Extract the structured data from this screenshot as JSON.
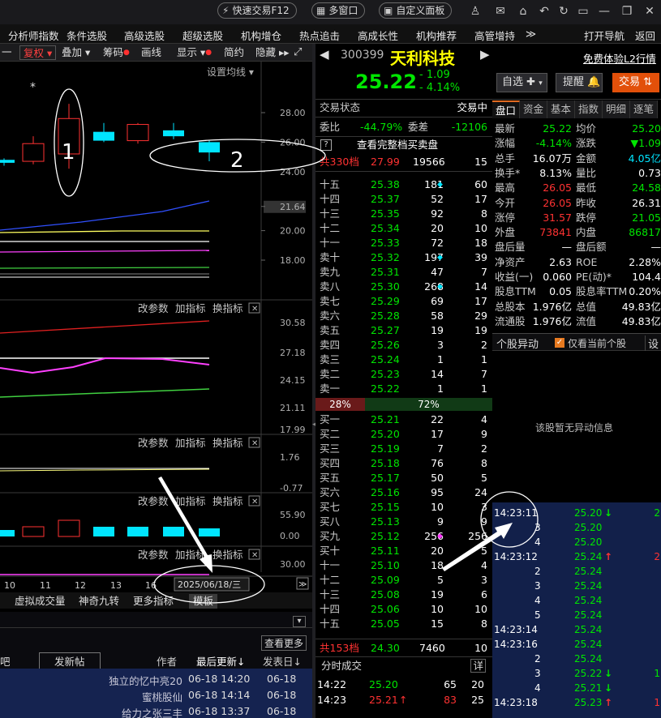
{
  "titlebar": {
    "quick_trade": "快速交易F12",
    "multi_window": "多窗口",
    "custom_panel": "自定义面板"
  },
  "menu": [
    "分析师指数",
    "条件选股",
    "高级选股",
    "超级选股",
    "机构增仓",
    "热点追击",
    "高成长性",
    "机构推荐",
    "高管增持",
    "≫",
    "打开导航",
    "返回"
  ],
  "toolbar": {
    "restore": "复权",
    "overlay": "叠加",
    "chips": "筹码",
    "draw": "画线",
    "display": "显示",
    "simple": "简约",
    "hide": "隐藏",
    "ma_setting": "设置均线"
  },
  "chart": {
    "candles": [
      {
        "open": 24.6,
        "close": 24.8,
        "high": 24.9,
        "low": 24.4,
        "color": "cyan"
      },
      {
        "open": 24.7,
        "close": 25.9,
        "high": 26.4,
        "low": 24.5,
        "color": "red"
      },
      {
        "open": 25.2,
        "close": 27.6,
        "high": 28.6,
        "low": 24.2,
        "color": "red"
      },
      {
        "open": 26.7,
        "close": 26.1,
        "high": 27.3,
        "low": 26.0,
        "color": "cyan"
      },
      {
        "open": 26.1,
        "close": 27.2,
        "high": 27.3,
        "low": 25.9,
        "color": "red"
      },
      {
        "open": 26.8,
        "close": 26.4,
        "high": 27.3,
        "low": 26.2,
        "color": "cyan"
      },
      {
        "open": 26.0,
        "close": 25.3,
        "high": 26.1,
        "low": 24.7,
        "color": "cyan"
      }
    ],
    "price_ticks": [
      "28.00",
      "26.00",
      "24.00",
      "21.64",
      "20.00",
      "18.00"
    ],
    "ind1_ticks": [
      "30.58",
      "27.18",
      "24.15",
      "21.11",
      "17.99"
    ],
    "ind2_ticks": [
      "1.76",
      "-0.77"
    ],
    "ind3_ticks": [
      "55.90",
      "0.00"
    ],
    "ind4_ticks": [
      "30.00"
    ],
    "panel_btns": [
      "改参数",
      "加指标",
      "换指标"
    ],
    "x_labels": [
      "10",
      "11",
      "12",
      "13",
      "16"
    ],
    "date_label": "2025/06/18/三",
    "annot1": "1",
    "annot2": "2",
    "star": "*"
  },
  "bottom_tabs": [
    "虚拟成交量",
    "神奇九转",
    "更多指标",
    "模板"
  ],
  "forum": {
    "more": "查看更多",
    "headers": [
      "吧",
      "发新帖",
      "作者",
      "最后更新↓",
      "发表日↓"
    ],
    "posts": [
      [
        "独立的忆中亮20",
        "06-18 14:20",
        "06-18"
      ],
      [
        "蜜桃股仙",
        "06-18 14:14",
        "06-18"
      ],
      [
        "给力之张三丰",
        "06-18 13:37",
        "06-18"
      ]
    ]
  },
  "stock": {
    "code": "300399",
    "name": "天利科技",
    "l2": "免费体验L2行情",
    "price": "25.22",
    "change": "- 1.09",
    "pct": "- 4.14%",
    "watch": "自选",
    "alert": "提醒",
    "trade": "交易"
  },
  "orderbook": {
    "status_label": "交易状态",
    "status": "交易中",
    "wb_label": "委比",
    "wb": "-44.79%",
    "wc_label": "委差",
    "wc": "-12106",
    "full_label": "查看完整档买卖盘",
    "sell_total": {
      "label": "共330档",
      "price": "27.99",
      "vol": "19566",
      "n": "15"
    },
    "sells": [
      [
        "十五",
        "25.38",
        "181",
        "◆",
        "60"
      ],
      [
        "十四",
        "25.37",
        "52",
        "◆",
        "17"
      ],
      [
        "十三",
        "25.35",
        "92",
        "◆",
        "8"
      ],
      [
        "十二",
        "25.34",
        "20",
        "◆",
        "10"
      ],
      [
        "十一",
        "25.33",
        "72",
        "◆",
        "18"
      ],
      [
        "卖十",
        "25.32",
        "197",
        "◆",
        "39"
      ],
      [
        "卖九",
        "25.31",
        "47",
        "◆",
        "7"
      ],
      [
        "卖八",
        "25.30",
        "268",
        "◆",
        "14"
      ],
      [
        "卖七",
        "25.29",
        "69",
        "◆",
        "17"
      ],
      [
        "卖六",
        "25.28",
        "58",
        "◆",
        "29"
      ],
      [
        "卖五",
        "25.27",
        "19",
        "◆",
        "19"
      ],
      [
        "卖四",
        "25.26",
        "3",
        "◆",
        "2"
      ],
      [
        "卖三",
        "25.24",
        "1",
        "◆",
        "1"
      ],
      [
        "卖二",
        "25.23",
        "14",
        "◆",
        "7"
      ],
      [
        "卖一",
        "25.22",
        "1",
        "◆",
        "1"
      ]
    ],
    "ratio_sell": "28%",
    "ratio_buy": "72%",
    "buys": [
      [
        "买一",
        "25.21",
        "22",
        "◆",
        "4"
      ],
      [
        "买二",
        "25.20",
        "17",
        "◆",
        "9"
      ],
      [
        "买三",
        "25.19",
        "7",
        "◆",
        "2"
      ],
      [
        "买四",
        "25.18",
        "76",
        "◆",
        "8"
      ],
      [
        "买五",
        "25.17",
        "50",
        "◆",
        "5"
      ],
      [
        "买六",
        "25.16",
        "95",
        "◆",
        "24"
      ],
      [
        "买七",
        "25.15",
        "10",
        "◆",
        "3"
      ],
      [
        "买八",
        "25.13",
        "9",
        "◆",
        "9"
      ],
      [
        "买九",
        "25.12",
        "256",
        "◆",
        "256"
      ],
      [
        "买十",
        "25.11",
        "20",
        "◆",
        "5"
      ],
      [
        "十一",
        "25.10",
        "18",
        "◆",
        "4"
      ],
      [
        "十二",
        "25.09",
        "5",
        "◆",
        "3"
      ],
      [
        "十三",
        "25.08",
        "19",
        "◆",
        "6"
      ],
      [
        "十四",
        "25.06",
        "10",
        "◆",
        "10"
      ],
      [
        "十五",
        "25.05",
        "15",
        "◆",
        "8"
      ]
    ],
    "buy_total": {
      "label": "共153档",
      "price": "24.30",
      "vol": "7460",
      "n": "10"
    },
    "ticks_title": "分时成交",
    "ticks_detail": "详",
    "ticks": [
      [
        "14:22",
        "25.20",
        "",
        "65",
        "20"
      ],
      [
        "14:23",
        "25.21",
        "↑",
        "83",
        "25"
      ]
    ]
  },
  "tabs": [
    "盘口",
    "资金",
    "基本",
    "指数",
    "明细",
    "逐笔"
  ],
  "quote": [
    [
      "最新",
      "25.22",
      "均价",
      "25.20"
    ],
    [
      "涨幅",
      "-4.14%",
      "涨跌",
      "▼1.09"
    ],
    [
      "总手",
      "16.07万",
      "金额",
      "4.05亿"
    ],
    [
      "换手*",
      "8.13%",
      "量比",
      "0.73"
    ],
    [
      "最高",
      "26.05",
      "最低",
      "24.58"
    ],
    [
      "今开",
      "26.05",
      "昨收",
      "26.31"
    ],
    [
      "涨停",
      "31.57",
      "跌停",
      "21.05"
    ],
    [
      "外盘",
      "73841",
      "内盘",
      "86817"
    ],
    [
      "盘后量",
      "—",
      "盘后额",
      "—"
    ],
    [
      "净资产",
      "2.63",
      "ROE",
      "2.28%"
    ],
    [
      "收益(一)",
      "0.060",
      "PE(动)*",
      "104.4"
    ],
    [
      "股息TTM",
      "0.05",
      "股息率TTM",
      "0.20%"
    ],
    [
      "总股本",
      "1.976亿",
      "总值",
      "49.83亿"
    ],
    [
      "流通股",
      "1.976亿",
      "流值",
      "49.83亿"
    ]
  ],
  "anomaly": {
    "title": "个股异动",
    "only_current": "仅看当前个股",
    "settings": "设",
    "empty": "该股暂无异动信息"
  },
  "trades": [
    [
      "14:23:11",
      "25.20",
      "↓",
      "2"
    ],
    [
      "3",
      "25.20",
      "",
      ""
    ],
    [
      "4",
      "25.20",
      "",
      ""
    ],
    [
      "14:23:12",
      "25.24",
      "↑",
      "2"
    ],
    [
      "2",
      "25.24",
      "",
      ""
    ],
    [
      "3",
      "25.24",
      "",
      ""
    ],
    [
      "4",
      "25.24",
      "",
      ""
    ],
    [
      "5",
      "25.24",
      "",
      ""
    ],
    [
      "14:23:14",
      "25.24",
      "",
      ""
    ],
    [
      "14:23:16",
      "25.24",
      "",
      ""
    ],
    [
      "2",
      "25.24",
      "",
      ""
    ],
    [
      "3",
      "25.22",
      "↓",
      "1"
    ],
    [
      "4",
      "25.21",
      "↓",
      ""
    ],
    [
      "14:23:18",
      "25.23",
      "↑",
      "1"
    ]
  ]
}
